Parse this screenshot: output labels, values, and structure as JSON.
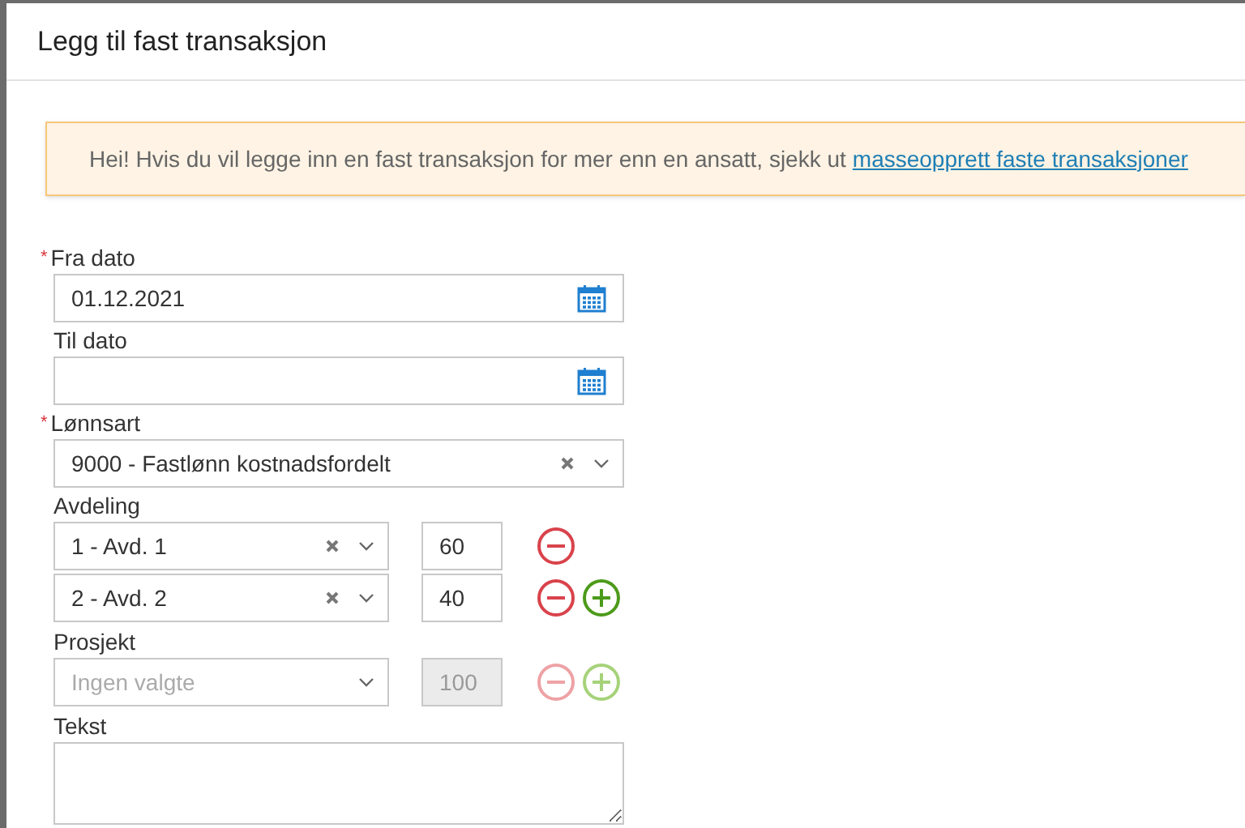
{
  "dialog": {
    "title": "Legg til fast transaksjon"
  },
  "notice": {
    "text": "Hei! Hvis du vil legge inn en fast transaksjon for mer enn en ansatt, sjekk ut",
    "link": "masseopprett faste transaksjoner"
  },
  "date_fields": [
    {
      "marker": "*",
      "label": "Fra dato",
      "value": "01.12.2021"
    },
    {
      "label": "Til dato"
    }
  ],
  "wage_type": {
    "marker": "*",
    "label": "Lønnsart",
    "value": "9000 - Fastlønn kostnadsfordelt"
  },
  "allocations": [
    {
      "label": "Avdeling",
      "rows": [
        {
          "value": "1 - Avd. 1",
          "amount": "60",
          "disabled": false,
          "show_add": false
        },
        {
          "value": "2 - Avd. 2",
          "amount": "40",
          "disabled": false,
          "show_add": true
        }
      ]
    },
    {
      "label": "Prosjekt",
      "rows": [
        {
          "placeholder": "Ingen valgte",
          "amount": "100",
          "disabled": true,
          "show_add": true
        }
      ]
    }
  ],
  "text_field": {
    "label": "Tekst"
  }
}
